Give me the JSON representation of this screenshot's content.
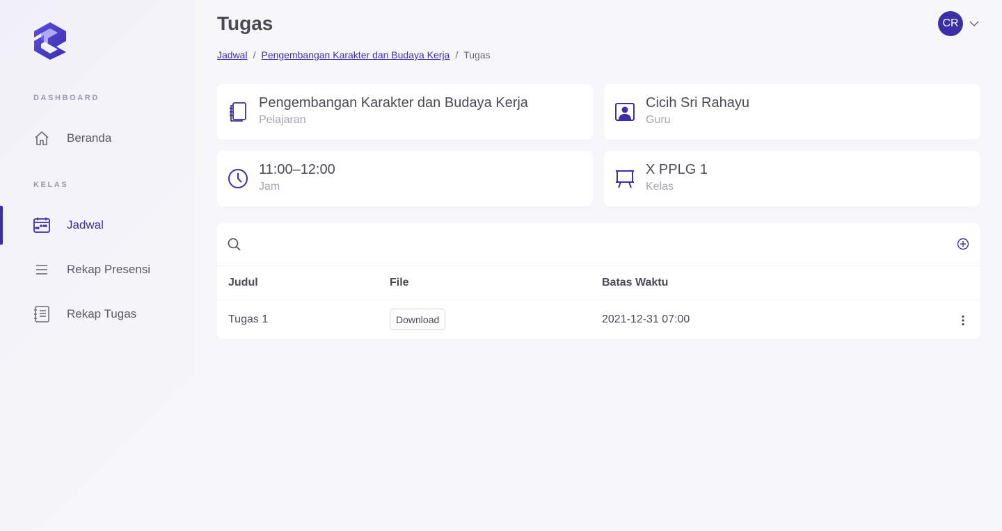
{
  "sidebar": {
    "sections": [
      "DASHBOARD",
      "KELAS"
    ],
    "items": [
      {
        "label": "Beranda",
        "icon": "home-icon",
        "active": false
      },
      {
        "label": "Jadwal",
        "icon": "calendar-icon",
        "active": true
      },
      {
        "label": "Rekap Presensi",
        "icon": "list-icon",
        "active": false
      },
      {
        "label": "Rekap Tugas",
        "icon": "document-list-icon",
        "active": false
      }
    ]
  },
  "header": {
    "title": "Tugas",
    "avatar_initials": "CR",
    "breadcrumb": [
      "Jadwal",
      "Pengembangan Karakter dan Budaya Kerja",
      "Tugas"
    ],
    "breadcrumb_sep": "/"
  },
  "info": {
    "subject": {
      "value": "Pengembangan Karakter dan Budaya Kerja",
      "label": "Pelajaran"
    },
    "teacher": {
      "value": "Cicih Sri Rahayu",
      "label": "Guru"
    },
    "time": {
      "value": "11:00–12:00",
      "label": "Jam"
    },
    "class": {
      "value": "X PPLG 1",
      "label": "Kelas"
    }
  },
  "table": {
    "search_placeholder": "",
    "columns": [
      "Judul",
      "File",
      "Batas Waktu"
    ],
    "rows": [
      {
        "judul": "Tugas 1",
        "file_button": "Download",
        "batas_waktu": "2021-12-31 07:00"
      }
    ]
  },
  "colors": {
    "accent": "#3b2fa6",
    "background": "#f6f6f9",
    "card": "#ffffff"
  }
}
